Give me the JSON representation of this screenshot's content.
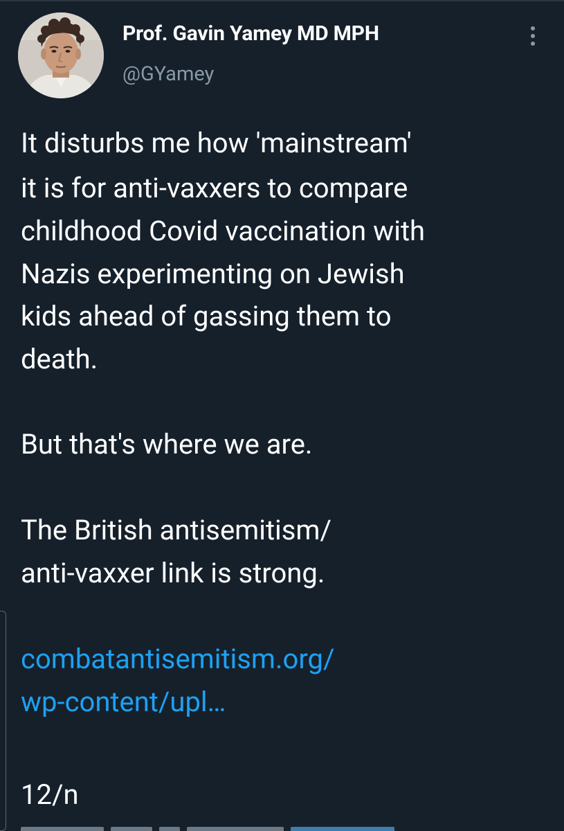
{
  "author": {
    "display_name": "Prof. Gavin Yamey MD MPH",
    "handle": "@GYamey"
  },
  "tweet": {
    "paragraph1": [
      "It disturbs me how 'mainstream'",
      "it is for anti-vaxxers to compare",
      "childhood Covid vaccination with",
      "Nazis experimenting on Jewish",
      "kids ahead of gassing them to",
      "death."
    ],
    "paragraph2": [
      "But that's where we are."
    ],
    "paragraph3": [
      "The British antisemitism/",
      "anti-vaxxer link is strong."
    ],
    "link_lines": [
      "combatantisemitism.org/",
      "wp-content/upl…"
    ],
    "thread_marker": "12/n"
  },
  "icons": {
    "more": "more-vertical-icon"
  },
  "colors": {
    "background": "#15202b",
    "text": "#ffffff",
    "secondary_text": "#8899a6",
    "link": "#1da1f2"
  }
}
